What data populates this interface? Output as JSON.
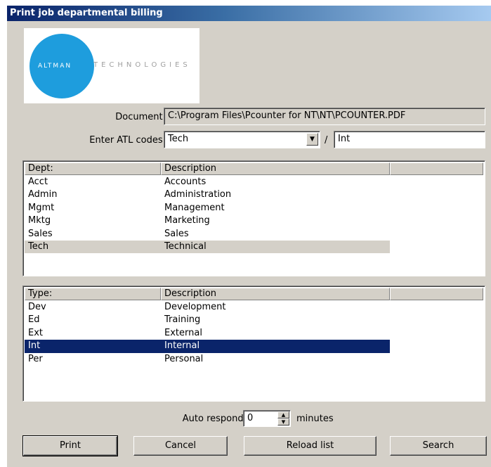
{
  "window": {
    "title": "Print job departmental billing"
  },
  "logo": {
    "word1": "ALTMAN",
    "word2": "TECHNOLOGIES"
  },
  "document": {
    "label": "Document:",
    "value": "C:\\Program Files\\Pcounter for NT\\NT\\PCOUNTER.PDF"
  },
  "atl": {
    "label": "Enter ATL codes:",
    "dept_value": "Tech",
    "separator": "/",
    "type_value": "Int"
  },
  "dept_list": {
    "headers": [
      "Dept:",
      "Description"
    ],
    "rows": [
      [
        "Acct",
        "Accounts"
      ],
      [
        "Admin",
        "Administration"
      ],
      [
        "Mgmt",
        "Management"
      ],
      [
        "Mktg",
        "Marketing"
      ],
      [
        "Sales",
        "Sales"
      ],
      [
        "Tech",
        "Technical"
      ]
    ],
    "selected_index": 5
  },
  "type_list": {
    "headers": [
      "Type:",
      "Description"
    ],
    "rows": [
      [
        "Dev",
        "Development"
      ],
      [
        "Ed",
        "Training"
      ],
      [
        "Ext",
        "External"
      ],
      [
        "Int",
        "Internal"
      ],
      [
        "Per",
        "Personal"
      ]
    ],
    "selected_index": 3
  },
  "auto_respond": {
    "label": "Auto respond:",
    "value": "0",
    "unit": "minutes"
  },
  "buttons": {
    "print": "Print",
    "cancel": "Cancel",
    "reload": "Reload list",
    "search": "Search"
  },
  "colors": {
    "selection": "#0a246a",
    "inactive_selection": "#d4d0c8",
    "logo_circle": "#1e9ddd",
    "face": "#d4d0c8"
  }
}
